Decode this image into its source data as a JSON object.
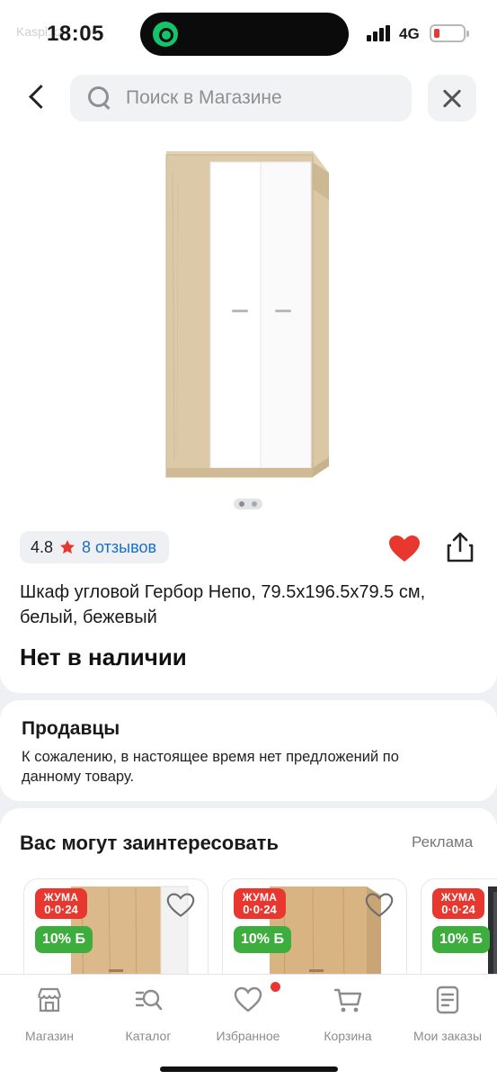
{
  "status_bar": {
    "time": "18:05",
    "back_app": "Kaspi.kz",
    "network": "4G"
  },
  "search": {
    "placeholder": "Поиск в Магазине"
  },
  "product": {
    "rating": "4.8",
    "reviews": "8 отзывов",
    "title": "Шкаф угловой Гербор Непо, 79.5x196.5x79.5 см, белый, бежевый",
    "stock_status": "Нет в наличии",
    "image_count": 2,
    "favorited": true
  },
  "sellers": {
    "title": "Продавцы",
    "text": "К сожалению, в настоящее время нет предложений по данному товару."
  },
  "recommendations": {
    "title": "Вас могут заинтересовать",
    "ad_label": "Реклама",
    "items": [
      {
        "sale_line1": "ЖУМА",
        "sale_line2": "0·0·24",
        "bonus": "10% Б"
      },
      {
        "sale_line1": "ЖУМА",
        "sale_line2": "0·0·24",
        "bonus": "10% Б"
      },
      {
        "sale_line1": "ЖУМА",
        "sale_line2": "0·0·24",
        "bonus": "10% Б"
      }
    ]
  },
  "nav": {
    "items": [
      {
        "label": "Магазин",
        "icon": "store-icon"
      },
      {
        "label": "Каталог",
        "icon": "catalog-icon"
      },
      {
        "label": "Избранное",
        "icon": "heart-icon"
      },
      {
        "label": "Корзина",
        "icon": "cart-icon"
      },
      {
        "label": "Мои заказы",
        "icon": "orders-icon"
      }
    ]
  },
  "colors": {
    "accent_red": "#e8372f",
    "link_blue": "#1a6fc4",
    "bonus_green": "#3dae3d",
    "background": "#eef0f3"
  }
}
